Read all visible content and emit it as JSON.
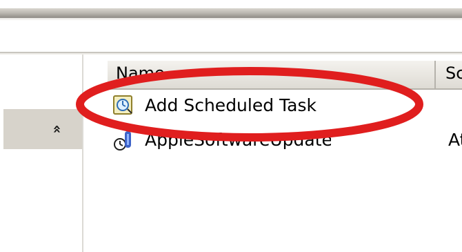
{
  "window": {
    "columns": {
      "name_label": "Name",
      "schedule_label": "Sc"
    },
    "left_panel": {
      "collapse_icon": "double-chevron-up-icon",
      "collapse_glyph": "»"
    },
    "rows": [
      {
        "label": "Add Scheduled Task",
        "icon": "scheduled-task-wizard-icon"
      },
      {
        "label": "AppleSoftwareUpdate",
        "icon": "clock-task-icon",
        "schedule": "At"
      }
    ]
  },
  "annotation": {
    "shape": "ellipse",
    "color": "#e01e1e"
  }
}
